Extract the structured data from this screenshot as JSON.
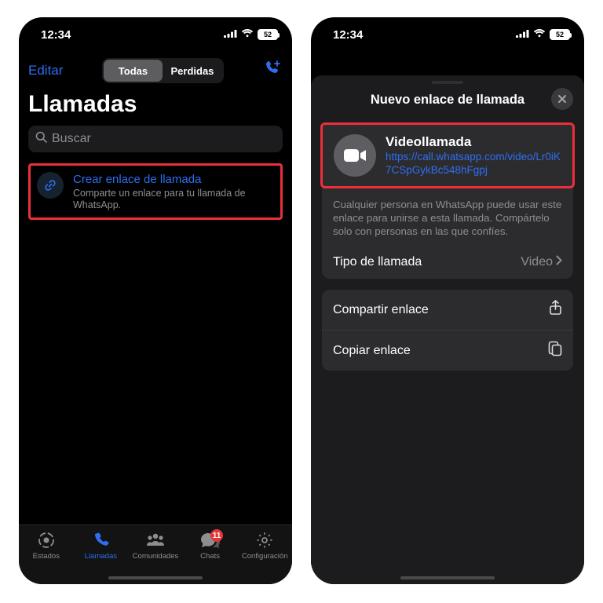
{
  "status": {
    "time": "12:34",
    "battery": "52"
  },
  "left": {
    "edit": "Editar",
    "seg_all": "Todas",
    "seg_missed": "Perdidas",
    "title": "Llamadas",
    "search_placeholder": "Buscar",
    "create_title": "Crear enlace de llamada",
    "create_sub": "Comparte un enlace para tu llamada de WhatsApp.",
    "tabs": {
      "states": "Estados",
      "calls": "Llamadas",
      "communities": "Comunidades",
      "chats": "Chats",
      "settings": "Configuración",
      "chats_badge": "11"
    }
  },
  "right": {
    "sheet_title": "Nuevo enlace de llamada",
    "video_label": "Videollamada",
    "video_url": "https://call.whatsapp.com/video/Lr0iK7CSpGykBc548hFgpj",
    "desc": "Cualquier persona en WhatsApp puede usar este enlace para unirse a esta llamada. Compártelo solo con personas en las que confíes.",
    "type_label": "Tipo de llamada",
    "type_value": "Video",
    "share": "Compartir enlace",
    "copy": "Copiar enlace"
  }
}
